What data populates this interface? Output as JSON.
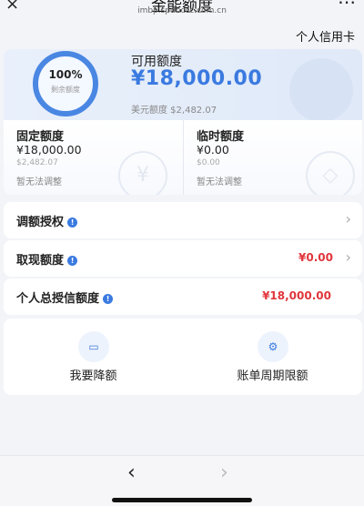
{
  "topbar": {
    "title": "金能额度",
    "url": "imbp.spdbccc.com.cn",
    "close_icon": "×",
    "more_icon": "⋯"
  },
  "card_type": "个人信用卡",
  "hero": {
    "percent": "100%",
    "percent_label": "剩余额度",
    "available_label": "可用额度",
    "available_value": "¥18,000.00",
    "usd_line": "美元额度 $2,482.07"
  },
  "fixed": {
    "label": "固定额度",
    "value": "¥18,000.00",
    "usd": "$2,482.07",
    "note": "暂无法调整"
  },
  "temporary": {
    "label": "临时额度",
    "value": "¥0.00",
    "usd": "$0.00",
    "note": "暂无法调整"
  },
  "rows": {
    "adjust": {
      "label": "调额授权"
    },
    "cash": {
      "label": "取现额度",
      "amount": "¥0.00"
    },
    "total": {
      "label": "个人总授信额度",
      "amount": "¥18,000.00"
    }
  },
  "actions": [
    {
      "label": "我要降额",
      "icon": "wallet-icon"
    },
    {
      "label": "账单周期限额",
      "icon": "gear-icon"
    }
  ],
  "nav": {
    "back": "‹",
    "forward": "›"
  },
  "colors": {
    "accent": "#3a7ae0",
    "negative": "#e0363c",
    "background": "#f3f4f8"
  }
}
